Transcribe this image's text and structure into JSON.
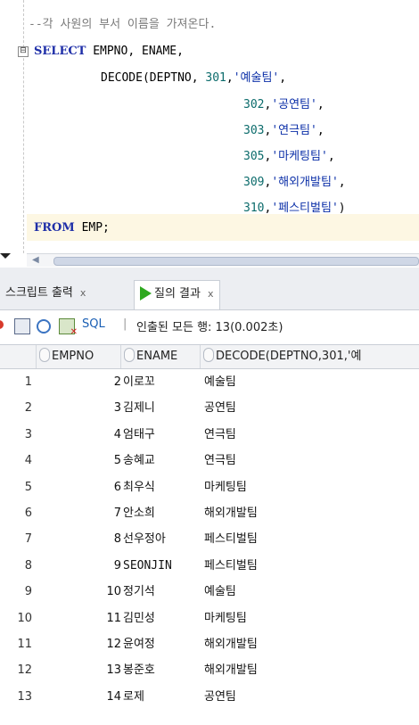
{
  "editor": {
    "comment": "--각 사원의 부서 이름을 가져온다.",
    "fold_toggle": "⊟",
    "line_select": {
      "kw": "SELECT",
      "rest": " EMPNO, ENAME,"
    },
    "line_decode": {
      "fn": "DECODE(DEPTNO, ",
      "num": "301",
      "sep": ",",
      "str": "'예술팀'",
      "end": ","
    },
    "case_lines": [
      {
        "num": "302",
        "str": "'공연팀'",
        "end": ","
      },
      {
        "num": "303",
        "str": "'연극팀'",
        "end": ","
      },
      {
        "num": "305",
        "str": "'마케팅팀'",
        "end": ","
      },
      {
        "num": "309",
        "str": "'해외개발팀'",
        "end": ","
      },
      {
        "num": "310",
        "str": "'페스티벌팀'",
        "end": ")"
      }
    ],
    "line_from": {
      "kw": "FROM",
      "rest": " EMP;"
    }
  },
  "tabs": {
    "script_output": {
      "label": "스크립트 출력",
      "close": "x"
    },
    "query_result": {
      "label": "질의 결과",
      "close": "x"
    }
  },
  "toolbar": {
    "sql_label": "SQL",
    "separator": "|",
    "status": "인출된 모든 행: 13(0.002초)"
  },
  "grid": {
    "columns": [
      "EMPNO",
      "ENAME",
      "DECODE(DEPTNO,301,'예"
    ],
    "rows": [
      {
        "idx": "1",
        "empno": "2",
        "ename": "이로꼬",
        "dept": "예술팀"
      },
      {
        "idx": "2",
        "empno": "3",
        "ename": "김제니",
        "dept": "공연팀"
      },
      {
        "idx": "3",
        "empno": "4",
        "ename": "엄태구",
        "dept": "연극팀"
      },
      {
        "idx": "4",
        "empno": "5",
        "ename": "송혜교",
        "dept": "연극팀"
      },
      {
        "idx": "5",
        "empno": "6",
        "ename": "최우식",
        "dept": "마케팅팀"
      },
      {
        "idx": "6",
        "empno": "7",
        "ename": "안소희",
        "dept": "해외개발팀"
      },
      {
        "idx": "7",
        "empno": "8",
        "ename": "선우정아",
        "dept": "페스티벌팀"
      },
      {
        "idx": "8",
        "empno": "9",
        "ename": "SEONJIN",
        "dept": "페스티벌팀"
      },
      {
        "idx": "9",
        "empno": "10",
        "ename": "정기석",
        "dept": "예술팀"
      },
      {
        "idx": "10",
        "empno": "11",
        "ename": "김민성",
        "dept": "마케팅팀"
      },
      {
        "idx": "11",
        "empno": "12",
        "ename": "윤여정",
        "dept": "해외개발팀"
      },
      {
        "idx": "12",
        "empno": "13",
        "ename": "봉준호",
        "dept": "해외개발팀"
      },
      {
        "idx": "13",
        "empno": "14",
        "ename": "로제",
        "dept": "공연팀"
      }
    ]
  },
  "icons": [
    "pin-icon",
    "print-icon",
    "refresh-icon",
    "export-excel-icon",
    "play-icon",
    "sort-icon"
  ],
  "colors": {
    "keyword": "#1f2fa8",
    "number": "#0b6b6b",
    "string": "#0b2fa8",
    "comment": "#7a7a7a",
    "current_line": "#fdf7e3",
    "play": "#2ea81f"
  }
}
